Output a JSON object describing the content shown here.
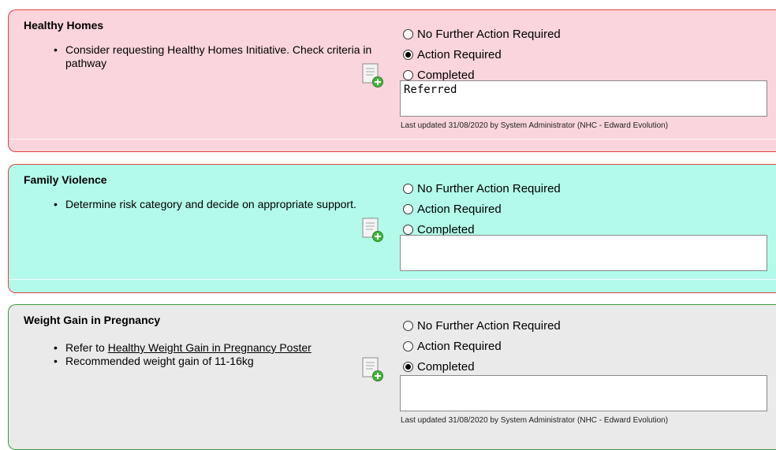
{
  "sections": [
    {
      "title": "Healthy Homes",
      "bullets": [
        {
          "text": "Consider requesting Healthy Homes Initiative. Check criteria in pathway"
        }
      ],
      "options": [
        "No Further Action Required",
        "Action Required",
        "Completed"
      ],
      "selected": 1,
      "comment": "Referred",
      "last_updated": "Last updated 31/08/2020 by System Administrator (NHC - Edward Evolution)",
      "bg": "#fad5dd",
      "border": "#e3413f"
    },
    {
      "title": "Family Violence",
      "bullets": [
        {
          "text": "Determine risk category and decide on appropriate support."
        }
      ],
      "options": [
        "No Further Action Required",
        "Action Required",
        "Completed"
      ],
      "selected": -1,
      "comment": "",
      "last_updated": "",
      "bg": "#b3faea",
      "border": "#e3413f"
    },
    {
      "title": "Weight Gain in Pregnancy",
      "bullets": [
        {
          "prefix": "Refer to ",
          "link": "Healthy Weight Gain in Pregnancy Poster"
        },
        {
          "text": "Recommended weight gain of 11-16kg"
        }
      ],
      "options": [
        "No Further Action Required",
        "Action Required",
        "Completed"
      ],
      "selected": 2,
      "comment": "",
      "last_updated": "Last updated 31/08/2020 by System Administrator (NHC - Edward Evolution)",
      "bg": "#eaeaea",
      "border": "#3d9a3d"
    }
  ],
  "icons": {
    "note": "add-note-icon"
  }
}
